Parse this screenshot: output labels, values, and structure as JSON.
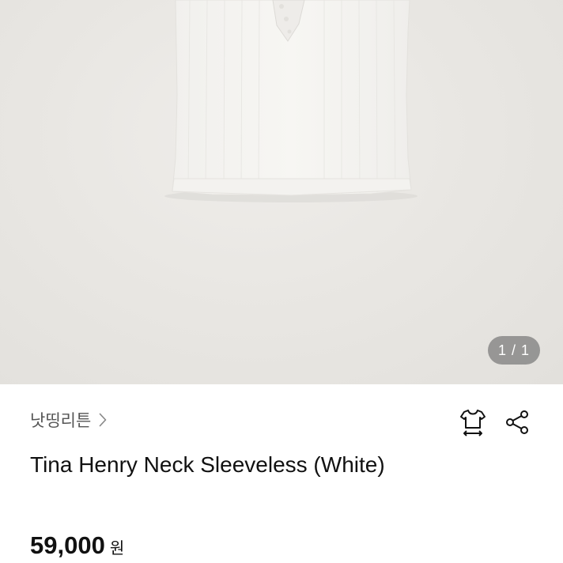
{
  "gallery": {
    "counter": "1 / 1",
    "background_color": "#e9e7e3"
  },
  "product": {
    "brand": "낫띵리튼",
    "title": "Tina Henry Neck Sleeveless (White)",
    "price": "59,000",
    "currency": "원"
  },
  "icons": {
    "brand_link": "chevron-right-icon",
    "size_guide": "tshirt-size-icon",
    "share": "share-icon"
  }
}
